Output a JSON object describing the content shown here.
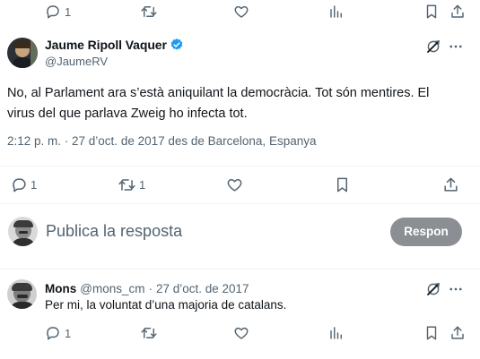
{
  "prev_tweet": {
    "reply_count": "1"
  },
  "main_tweet": {
    "author_name": "Jaume Ripoll Vaquer",
    "handle": "@JaumeRV",
    "text_line1": "No, al Parlament ara s’està aniquilant la democràcia. Tot són mentires. El",
    "text_line2": "virus del que parlava Zweig ho infecta tot.",
    "meta": "2:12 p. m. · 27 d’oct. de 2017 des de Barcelona, Espanya",
    "reply_count": "1",
    "retweet_count": "1",
    "verified_color": "#1d9bf0"
  },
  "reply_box": {
    "placeholder": "Publica la resposta",
    "button_label": "Respon"
  },
  "reply": {
    "author_name": "Mons",
    "handle": "@mons_cm",
    "separator": "·",
    "date": "27 d’oct. de 2017",
    "text": "Per mi, la voluntat d’una majoria de catalans.",
    "reply_count": "1"
  },
  "icons": [
    "reply-icon",
    "retweet-icon",
    "like-icon",
    "views-icon",
    "bookmark-icon",
    "share-icon",
    "grok-icon",
    "more-icon",
    "verified-icon"
  ]
}
